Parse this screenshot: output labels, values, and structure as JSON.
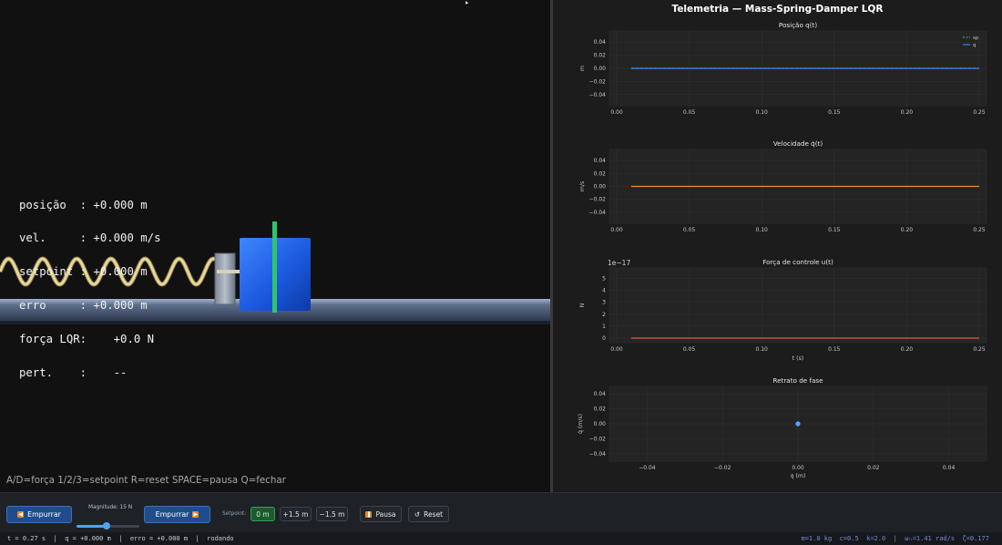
{
  "sim": {
    "readouts": [
      "posição  : +0.000 m",
      "vel.     : +0.000 m/s",
      "setpoint : +0.000 m",
      "erro     : +0.000 m",
      "força LQR:    +0.0 N",
      "pert.    :    --"
    ],
    "hint": "A/D=força  1/2/3=setpoint  R=reset  SPACE=pausa  Q=fechar",
    "colors": {
      "spring": "#e8d79a",
      "mass": "#1f5fe0",
      "setpoint_marker": "#2fc46a",
      "rail": "#8ea2c0"
    }
  },
  "telemetry": {
    "title": "Telemetria — Mass-Spring-Damper LQR",
    "x_ticks": [
      "0.00",
      "0.05",
      "0.10",
      "0.15",
      "0.20",
      "0.25"
    ],
    "plots": [
      {
        "title": "Posição q(t)",
        "ylabel": "m",
        "yticks": [
          "0.04",
          "0.02",
          "0.00",
          "−0.02",
          "−0.04"
        ],
        "line_color": "#3b82f6",
        "legend": [
          "sp",
          "q"
        ]
      },
      {
        "title": "Velocidade q̇(t)",
        "ylabel": "m/s",
        "yticks": [
          "0.04",
          "0.02",
          "0.00",
          "−0.02",
          "−0.04"
        ],
        "line_color": "#f28e2b"
      },
      {
        "title": "Força de controle u(t)",
        "ylabel": "N",
        "yticks": [
          "5",
          "4",
          "3",
          "2",
          "1",
          "0"
        ],
        "line_color": "#e4574c",
        "offset": "1e−17",
        "xlabel": "t (s)"
      }
    ],
    "phase": {
      "title": "Retrato de fase",
      "ylabel": "q̇ (m/s)",
      "xlabel": "q (m)",
      "yticks": [
        "0.04",
        "0.02",
        "0.00",
        "−0.02",
        "−0.04"
      ],
      "xticks": [
        "−0.04",
        "−0.02",
        "0.00",
        "0.02",
        "0.04"
      ],
      "point_color": "#58a6ff"
    }
  },
  "chart_data": [
    {
      "type": "line",
      "title": "Posição q(t)",
      "ylabel": "m",
      "ylim": [
        -0.05,
        0.05
      ],
      "xlim": [
        0.0,
        0.25
      ],
      "series": [
        {
          "name": "sp",
          "x": [
            0.01,
            0.25
          ],
          "y": [
            0.0,
            0.0
          ]
        },
        {
          "name": "q",
          "x": [
            0.01,
            0.25
          ],
          "y": [
            0.0,
            0.0
          ]
        }
      ]
    },
    {
      "type": "line",
      "title": "Velocidade q̇(t)",
      "ylabel": "m/s",
      "ylim": [
        -0.05,
        0.05
      ],
      "xlim": [
        0.0,
        0.25
      ],
      "series": [
        {
          "x": [
            0.01,
            0.25
          ],
          "y": [
            0.0,
            0.0
          ]
        }
      ]
    },
    {
      "type": "line",
      "title": "Força de controle u(t)",
      "ylabel": "N",
      "xlabel": "t (s)",
      "ylim": [
        0,
        5.5
      ],
      "xlim": [
        0.0,
        0.25
      ],
      "series": [
        {
          "x": [
            0.01,
            0.25
          ],
          "y": [
            0.0,
            0.0
          ]
        }
      ]
    },
    {
      "type": "scatter",
      "title": "Retrato de fase",
      "xlabel": "q (m)",
      "ylabel": "q̇ (m/s)",
      "xlim": [
        -0.05,
        0.05
      ],
      "ylim": [
        -0.05,
        0.05
      ],
      "series": [
        {
          "x": [
            0.0
          ],
          "y": [
            0.0
          ]
        }
      ]
    }
  ],
  "controls": {
    "push_left_label": "Empurrar",
    "magnitude_label": "Magnitude: 15 N",
    "magnitude_value": 15,
    "magnitude_fraction": 0.48,
    "push_right_label": "Empurrar",
    "setpoint_label": "Setpoint:",
    "setpoint_buttons": [
      "0 m",
      "+1.5 m",
      "−1.5 m"
    ],
    "pause_label": "Pausa",
    "reset_label": "Reset"
  },
  "status": {
    "left": "t = 0.27 s  |  q = +0.000 m  |  erro = +0.000 m  |  rodando",
    "right": "m=1.0 kg  c=0.5  k=2.0  |  ωₙ=1.41 rad/s  ζ=0.177"
  }
}
